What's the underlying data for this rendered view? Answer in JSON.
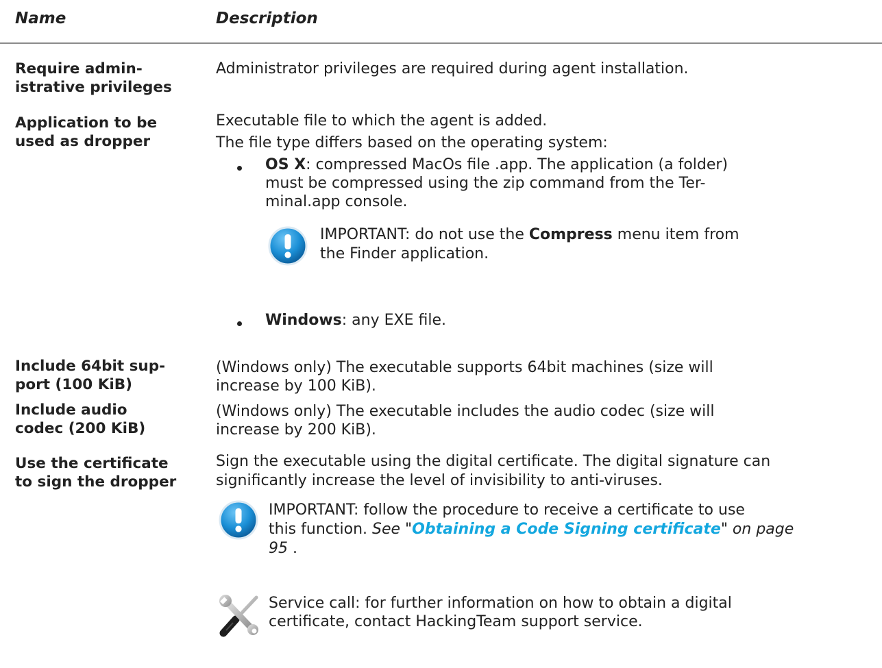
{
  "header": {
    "name": "Name",
    "description": "Description"
  },
  "rows": [
    {
      "name_l1": "Require admin-",
      "name_l2": "istrative privileges",
      "desc": "Administrator privileges are required during agent installation."
    },
    {
      "name_l1": "Application to be",
      "name_l2": "used as dropper",
      "desc_l1": "Executable file to which the agent is added.",
      "desc_l2": "The file type differs based on the operating system:",
      "bullet1_bold": "OS X",
      "bullet1_l1_rest": ": compressed MacOs file .app. The application (a folder)",
      "bullet1_l2": "must be compressed using the zip command from the Ter-",
      "bullet1_l3": "minal.app console.",
      "note_pre": "IMPORTANT: do not use the ",
      "note_bold": "Compress",
      "note_post": " menu item from",
      "note_l2": "the Finder application.",
      "bullet2_bold": "Windows",
      "bullet2_rest": ": any EXE file."
    },
    {
      "name_l1": "Include 64bit sup-",
      "name_l2": "port (100 KiB)",
      "desc_l1": "(Windows only) The executable supports 64bit machines (size will",
      "desc_l2": "increase by 100 KiB)."
    },
    {
      "name_l1": "Include audio",
      "name_l2": "codec (200 KiB)",
      "desc_l1": "(Windows only) The executable includes the audio codec (size will",
      "desc_l2": "increase by 200 KiB)."
    },
    {
      "name_l1": "Use the certificate",
      "name_l2": "to sign the dropper",
      "desc_l1": "Sign the executable using the digital certificate. The digital signature can",
      "desc_l2": "significantly increase the level of invisibility to anti-viruses.",
      "note_l1": "IMPORTANT: follow the procedure to receive a certificate to use",
      "note_l2_pre": "this function. ",
      "see": "See",
      "q_open": " \"",
      "link_text": "Obtaining a Code Signing certificate",
      "q_close": "\"",
      "on_page": " on page",
      "page_num": "95",
      "period": " .",
      "service_l1": "Service call: for further information on how to obtain a digital",
      "service_l2": "certificate, contact HackingTeam support service."
    }
  ],
  "icons": {
    "important": "important-exclamation-icon",
    "service": "wrench-screwdriver-icon"
  },
  "colors": {
    "link": "#13a7df",
    "icon_blue": "#1b8fd6"
  }
}
